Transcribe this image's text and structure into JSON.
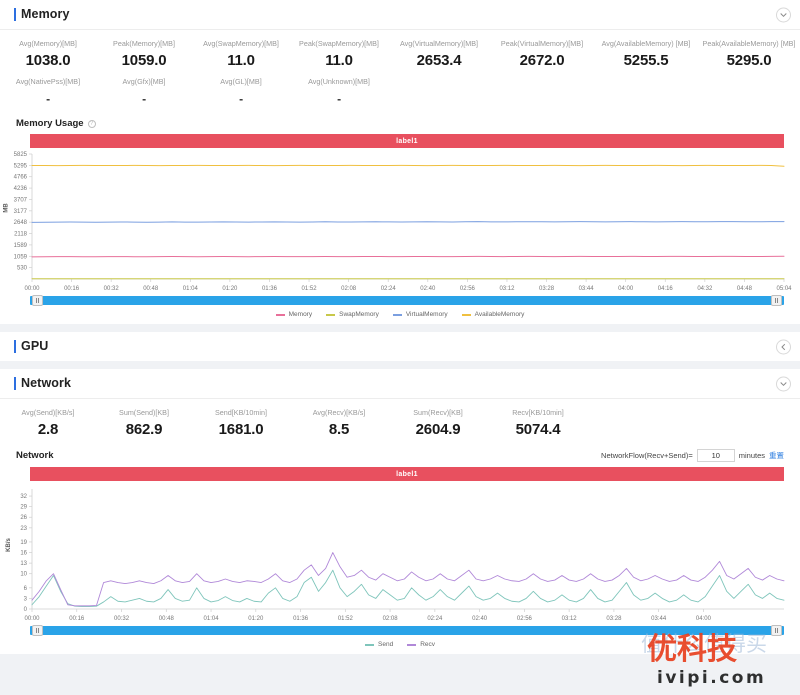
{
  "theme": {
    "accent": "#2d6fe0",
    "label_bar": "#e8505f",
    "scroll": "#2aa3e8",
    "series_memory": "#e8709a",
    "series_swap": "#c8c84a",
    "series_virtual": "#7b9fe0",
    "series_available": "#f0c040",
    "series_send": "#7fc5bb",
    "series_recv": "#b088d8"
  },
  "sections": [
    {
      "id": "memory",
      "title": "Memory",
      "collapse_icon": "chevron-down-icon",
      "expanded": true
    },
    {
      "id": "gpu",
      "title": "GPU",
      "collapse_icon": "chevron-left-icon",
      "expanded": false
    },
    {
      "id": "network",
      "title": "Network",
      "collapse_icon": "chevron-down-icon",
      "expanded": true
    }
  ],
  "memory": {
    "stats_row1": [
      {
        "label": "Avg(Memory)[MB]",
        "value": "1038.0"
      },
      {
        "label": "Peak(Memory)[MB]",
        "value": "1059.0"
      },
      {
        "label": "Avg(SwapMemory)[MB]",
        "value": "11.0"
      },
      {
        "label": "Peak(SwapMemory)[MB]",
        "value": "11.0"
      },
      {
        "label": "Avg(VirtualMemory)[MB]",
        "value": "2653.4"
      },
      {
        "label": "Peak(VirtualMemory)[MB]",
        "value": "2672.0"
      },
      {
        "label": "Avg(AvailableMemory) [MB]",
        "value": "5255.5"
      },
      {
        "label": "Peak(AvailableMemory) [MB]",
        "value": "5295.0"
      }
    ],
    "stats_row2": [
      {
        "label": "Avg(NativePss)[MB]",
        "value": "-"
      },
      {
        "label": "Avg(Gfx)[MB]",
        "value": "-"
      },
      {
        "label": "Avg(GL)[MB]",
        "value": "-"
      },
      {
        "label": "Avg(Unknown)[MB]",
        "value": "-"
      }
    ],
    "chart_title": "Memory Usage",
    "info_icon": "info-icon",
    "label_bar_text": "label1"
  },
  "network": {
    "stats_row1": [
      {
        "label": "Avg(Send)[KB/s]",
        "value": "2.8"
      },
      {
        "label": "Sum(Send)[KB]",
        "value": "862.9"
      },
      {
        "label": "Send[KB/10min]",
        "value": "1681.0"
      },
      {
        "label": "Avg(Recv)[KB/s]",
        "value": "8.5"
      },
      {
        "label": "Sum(Recv)[KB]",
        "value": "2604.9"
      },
      {
        "label": "Recv[KB/10min]",
        "value": "5074.4"
      }
    ],
    "chart_title": "Network",
    "flow_label": "NetworkFlow(Recv+Send)=",
    "flow_value": "10",
    "flow_unit": "minutes",
    "reset_link": "重置",
    "label_bar_text": "label1"
  },
  "watermark": {
    "brand": "优科技",
    "domain": "ivipi.com",
    "faint": "值什么值得买"
  },
  "chart_data": [
    {
      "type": "line",
      "id": "memory-usage",
      "title": "Memory Usage",
      "xlabel": "",
      "ylabel": "MB",
      "ylim": [
        0,
        5825
      ],
      "yticks": [
        5825,
        5295,
        4766,
        4236,
        3707,
        3177,
        2648,
        2118,
        1589,
        1059,
        530,
        0
      ],
      "xticks": [
        "00:00",
        "00:16",
        "00:32",
        "00:48",
        "01:04",
        "01:20",
        "01:36",
        "01:52",
        "02:08",
        "02:24",
        "02:40",
        "02:56",
        "03:12",
        "03:28",
        "03:44",
        "04:00",
        "04:16",
        "04:32",
        "04:48",
        "05:04"
      ],
      "grid": false,
      "legend_position": "bottom",
      "series": [
        {
          "name": "Memory",
          "color": "#e8709a",
          "values": [
            1030,
            1035,
            1040,
            1044,
            1038,
            1036,
            1041,
            1045,
            1039,
            1037,
            1042,
            1046,
            1040,
            1038,
            1043,
            1047,
            1041,
            1039,
            1044,
            1048,
            1042,
            1040,
            1045,
            1049,
            1043,
            1041,
            1046,
            1050,
            1044,
            1042,
            1047,
            1051,
            1045,
            1043,
            1048,
            1052,
            1046,
            1044,
            1049,
            1053,
            1047,
            1045,
            1050,
            1054,
            1048,
            1046,
            1051,
            1055,
            1049,
            1047,
            1052,
            1056,
            1050,
            1048,
            1053,
            1057,
            1051,
            1049,
            1054,
            1059
          ]
        },
        {
          "name": "SwapMemory",
          "color": "#c8c84a",
          "values": [
            11,
            11,
            11,
            11,
            11,
            11,
            11,
            11,
            11,
            11,
            11,
            11,
            11,
            11,
            11,
            11,
            11,
            11,
            11,
            11,
            11,
            11,
            11,
            11,
            11,
            11,
            11,
            11,
            11,
            11,
            11,
            11,
            11,
            11,
            11,
            11,
            11,
            11,
            11,
            11,
            11,
            11,
            11,
            11,
            11,
            11,
            11,
            11,
            11,
            11,
            11,
            11,
            11,
            11,
            11,
            11,
            11,
            11,
            11,
            11
          ]
        },
        {
          "name": "VirtualMemory",
          "color": "#7b9fe0",
          "values": [
            2640,
            2645,
            2650,
            2655,
            2648,
            2646,
            2652,
            2658,
            2650,
            2647,
            2653,
            2660,
            2652,
            2649,
            2655,
            2662,
            2654,
            2651,
            2657,
            2664,
            2656,
            2653,
            2659,
            2666,
            2658,
            2655,
            2661,
            2668,
            2660,
            2657,
            2663,
            2670,
            2662,
            2659,
            2665,
            2672,
            2664,
            2661,
            2667,
            2670,
            2665,
            2662,
            2668,
            2671,
            2666,
            2663,
            2669,
            2672,
            2667,
            2664,
            2670,
            2672,
            2668,
            2665,
            2671,
            2672,
            2669,
            2666,
            2671,
            2672
          ]
        },
        {
          "name": "AvailableMemory",
          "color": "#f0c040",
          "values": [
            5290,
            5288,
            5286,
            5292,
            5295,
            5291,
            5287,
            5289,
            5293,
            5290,
            5286,
            5288,
            5292,
            5295,
            5291,
            5287,
            5290,
            5293,
            5289,
            5286,
            5291,
            5294,
            5290,
            5287,
            5292,
            5295,
            5291,
            5288,
            5290,
            5293,
            5289,
            5286,
            5291,
            5294,
            5290,
            5287,
            5292,
            5295,
            5290,
            5288,
            5291,
            5294,
            5289,
            5286,
            5292,
            5295,
            5290,
            5287,
            5291,
            5293,
            5289,
            5286,
            5292,
            5294,
            5290,
            5288,
            5291,
            5295,
            5290,
            5255
          ]
        }
      ]
    },
    {
      "type": "line",
      "id": "network-flow",
      "title": "Network",
      "xlabel": "",
      "ylabel": "KB/s",
      "ylim": [
        0,
        34
      ],
      "yticks": [
        32,
        29,
        26,
        23,
        19,
        16,
        13,
        10,
        6,
        3,
        0
      ],
      "xticks": [
        "00:00",
        "00:16",
        "00:32",
        "00:48",
        "01:04",
        "01:20",
        "01:36",
        "01:52",
        "02:08",
        "02:24",
        "02:40",
        "02:56",
        "03:12",
        "03:28",
        "03:44",
        "04:00"
      ],
      "grid": false,
      "legend_position": "bottom",
      "series": [
        {
          "name": "Send",
          "color": "#7fc5bb",
          "values": [
            1.2,
            3.5,
            6.5,
            9.5,
            5.0,
            1.5,
            0.8,
            0.7,
            0.7,
            0.8,
            2.0,
            3.5,
            2.2,
            2.0,
            2.5,
            3.0,
            2.2,
            2.0,
            3.0,
            5.5,
            3.0,
            2.2,
            2.5,
            6.0,
            3.0,
            2.0,
            2.4,
            3.5,
            2.4,
            2.0,
            3.0,
            2.2,
            2.0,
            4.5,
            6.0,
            3.0,
            2.2,
            3.5,
            7.5,
            9.0,
            5.0,
            7.5,
            11.0,
            6.0,
            3.5,
            5.0,
            7.0,
            4.0,
            3.0,
            5.5,
            4.0,
            2.5,
            3.0,
            6.0,
            4.0,
            2.5,
            3.5,
            5.5,
            3.5,
            2.5,
            4.5,
            6.5,
            3.5,
            2.5,
            3.0,
            4.5,
            3.0,
            2.2,
            2.0,
            3.0,
            5.0,
            3.0,
            2.0,
            2.5,
            4.0,
            2.5,
            2.0,
            3.0,
            5.5,
            3.0,
            2.0,
            2.5,
            5.0,
            7.5,
            4.0,
            2.5,
            3.0,
            4.5,
            3.0,
            2.0,
            2.5,
            4.0,
            2.5,
            2.0,
            3.5,
            6.5,
            9.5,
            5.0,
            3.0,
            5.0,
            7.0,
            4.0,
            3.0,
            4.5,
            3.0,
            2.5
          ]
        },
        {
          "name": "Recv",
          "color": "#b088d8",
          "values": [
            2.5,
            5.0,
            8.0,
            10.0,
            5.5,
            1.2,
            0.9,
            0.9,
            0.9,
            1.0,
            7.5,
            8.0,
            7.5,
            7.2,
            7.5,
            8.0,
            7.5,
            7.2,
            8.0,
            9.5,
            8.0,
            7.5,
            7.8,
            10.0,
            8.0,
            7.5,
            7.8,
            8.5,
            7.8,
            7.5,
            8.0,
            7.8,
            7.5,
            8.5,
            10.0,
            8.0,
            7.5,
            8.5,
            11.0,
            12.5,
            9.5,
            11.5,
            16.0,
            12.0,
            9.0,
            9.5,
            11.0,
            9.0,
            8.2,
            10.0,
            9.0,
            8.0,
            8.5,
            10.5,
            9.0,
            8.0,
            8.5,
            10.0,
            8.5,
            8.0,
            9.5,
            11.0,
            8.5,
            8.0,
            8.5,
            9.5,
            8.5,
            8.0,
            7.8,
            8.5,
            10.0,
            8.5,
            7.8,
            8.2,
            9.5,
            8.2,
            7.8,
            8.5,
            10.0,
            8.5,
            7.8,
            8.2,
            9.5,
            11.5,
            9.0,
            8.0,
            8.5,
            9.5,
            8.5,
            7.8,
            8.2,
            9.5,
            8.2,
            7.8,
            9.0,
            11.0,
            13.5,
            9.5,
            8.5,
            10.0,
            11.5,
            9.0,
            8.2,
            9.5,
            8.5,
            8.0
          ]
        }
      ]
    }
  ]
}
